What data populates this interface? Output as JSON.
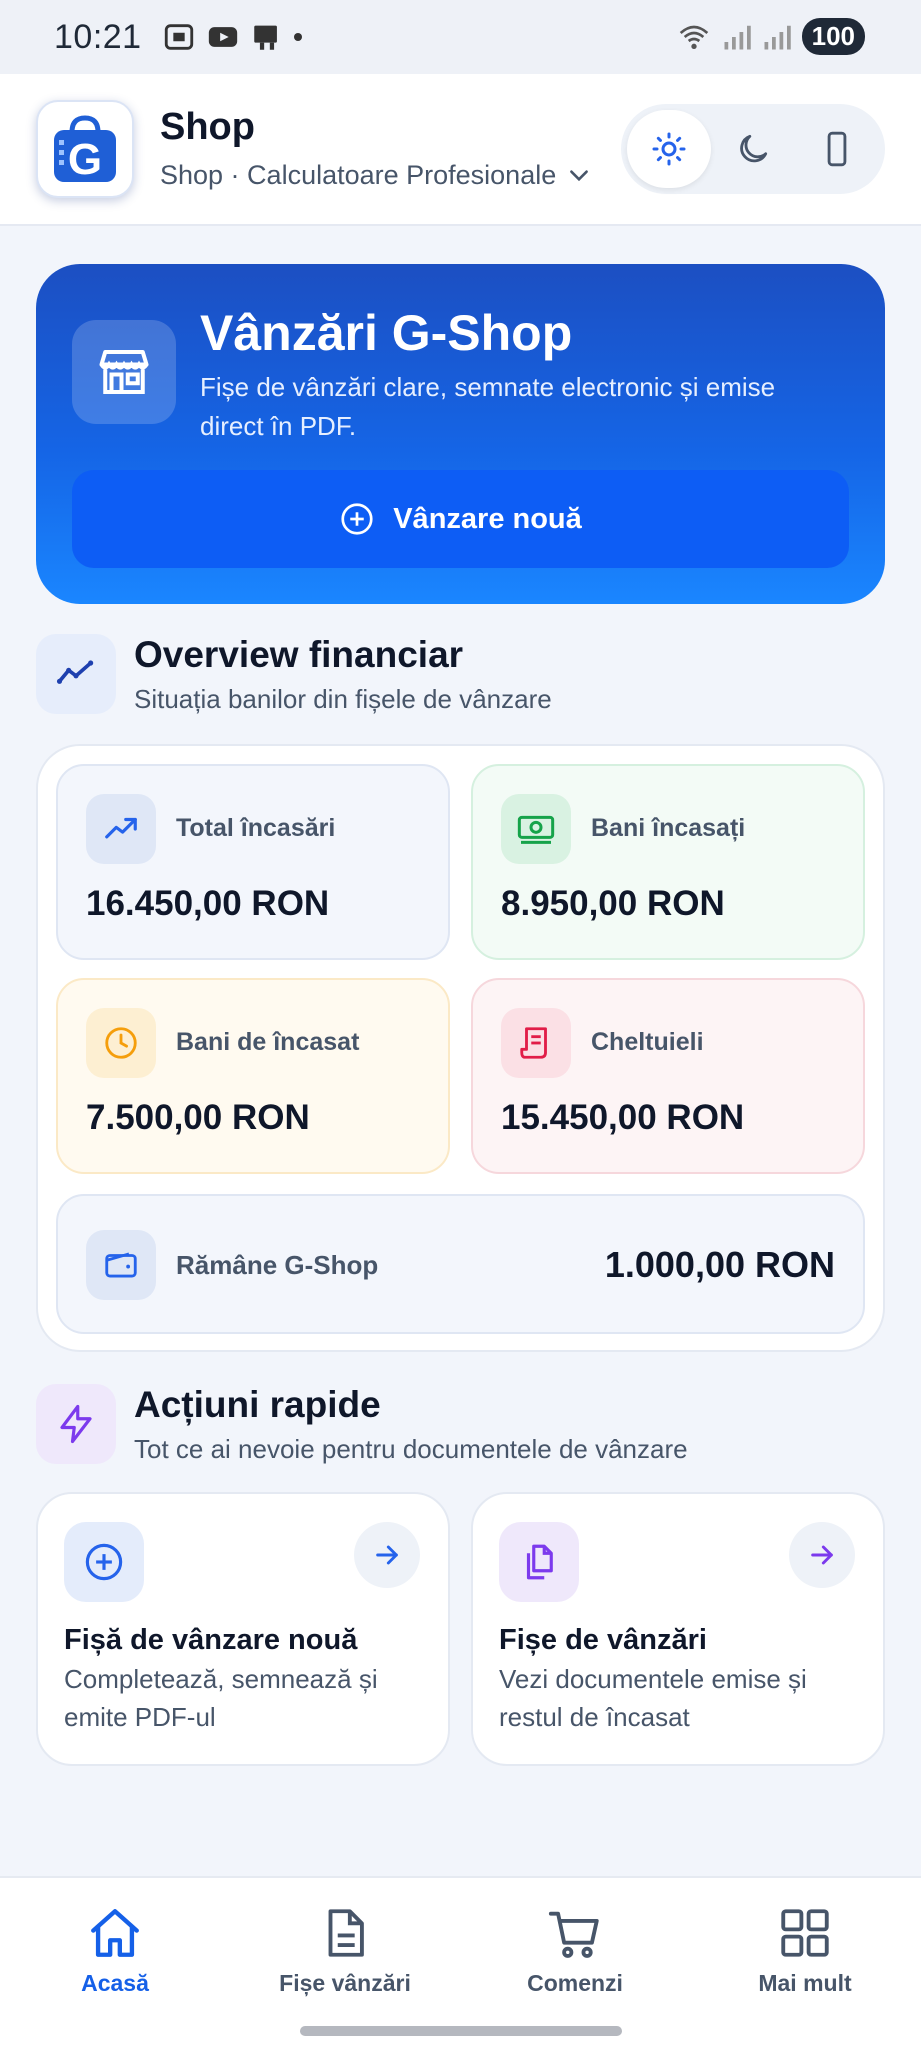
{
  "status_bar": {
    "time": "10:21",
    "battery": "100"
  },
  "header": {
    "title": "Shop",
    "subtitle": "Shop · Calculatoare Profesionale",
    "logo_letter": "G",
    "theme_options": [
      "sun-icon",
      "moon-icon",
      "phone-icon"
    ],
    "theme_selected": "light"
  },
  "hero": {
    "title": "Vânzări G-Shop",
    "description": "Fișe de vânzări clare, semnate electronic și emise direct în PDF.",
    "button_label": "Vânzare nouă",
    "icon": "store-icon"
  },
  "overview": {
    "title": "Overview financiar",
    "subtitle": "Situația banilor din fișele de vânzare",
    "cards": [
      {
        "label": "Total încasări",
        "value": "16.450,00 RON",
        "icon": "trending-up-icon",
        "color": "#2563eb"
      },
      {
        "label": "Bani încasați",
        "value": "8.950,00 RON",
        "icon": "banknote-icon",
        "color": "#16a34a"
      },
      {
        "label": "Bani de încasat",
        "value": "7.500,00 RON",
        "icon": "clock-icon",
        "color": "#f59e0b"
      },
      {
        "label": "Cheltuieli",
        "value": "15.450,00 RON",
        "icon": "receipt-icon",
        "color": "#e11d48"
      }
    ],
    "remaining": {
      "label": "Rămâne G-Shop",
      "value": "1.000,00 RON",
      "icon": "wallet-icon"
    }
  },
  "quick_actions": {
    "title": "Acțiuni rapide",
    "subtitle": "Tot ce ai nevoie pentru documentele de vânzare",
    "items": [
      {
        "title": "Fișă de vânzare nouă",
        "description": "Completează, semnează și emite PDF-ul",
        "icon": "plus-circle-icon",
        "color": "#2563eb"
      },
      {
        "title": "Fișe de vânzări",
        "description": "Vezi documentele emise și restul de încasat",
        "icon": "files-icon",
        "color": "#7c3aed"
      }
    ]
  },
  "bottom_nav": {
    "items": [
      {
        "label": "Acasă",
        "icon": "home-icon",
        "active": true
      },
      {
        "label": "Fișe vânzări",
        "icon": "document-icon",
        "active": false
      },
      {
        "label": "Comenzi",
        "icon": "cart-icon",
        "active": false
      },
      {
        "label": "Mai mult",
        "icon": "grid-icon",
        "active": false
      }
    ]
  },
  "colors": {
    "accent": "#1560e8",
    "hero_top": "#1c4fc2",
    "hero_bottom": "#1a86ff",
    "background": "#f2f5fb"
  }
}
